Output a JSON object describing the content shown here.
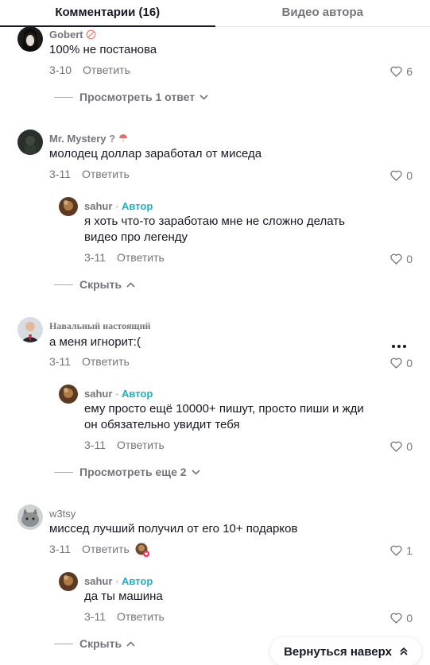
{
  "tabs": [
    {
      "label": "Комментарии (16)"
    },
    {
      "label": "Видео автора"
    }
  ],
  "comments": [
    {
      "username": "Gobert",
      "text": "100% не постанова",
      "date": "3-10",
      "reply_label": "Ответить",
      "likes": "6",
      "expander": "Просмотреть 1 ответ"
    },
    {
      "username": "Mr. Mystery",
      "text": "молодец доллар заработал от миседа",
      "date": "3-11",
      "reply_label": "Ответить",
      "likes": "0",
      "reply": {
        "username": "sahur",
        "author_badge": "Автор",
        "text_lines": [
          "я хоть что-то заработаю мне не сложно делать",
          "видео про легенду"
        ],
        "date": "3-11",
        "reply_label": "Ответить",
        "likes": "0"
      },
      "expander": "Скрыть"
    },
    {
      "username": "Навальный настоящий",
      "text": "а меня игнорит:(",
      "date": "3-11",
      "reply_label": "Ответить",
      "likes": "0",
      "reply": {
        "username": "sahur",
        "author_badge": "Автор",
        "text_lines": [
          "ему просто ещё 10000+ пишут, просто пиши и жди",
          "он обязательно увидит тебя"
        ],
        "date": "3-11",
        "reply_label": "Ответить",
        "likes": "0"
      },
      "expander": "Просмотреть еще 2"
    },
    {
      "username": "w3tsy",
      "text": "миссед лучший получил от его 10+ подарков",
      "date": "3-11",
      "reply_label": "Ответить",
      "likes": "1",
      "reply": {
        "username": "sahur",
        "author_badge": "Автор",
        "text_lines": [
          "да ты машина"
        ],
        "date": "3-11",
        "reply_label": "Ответить",
        "likes": "0"
      },
      "expander": "Скрыть"
    }
  ],
  "back_to_top": "Вернуться наверх",
  "colors": {
    "author": "#20b0c4",
    "muted": "#73757c",
    "text": "#161823"
  }
}
